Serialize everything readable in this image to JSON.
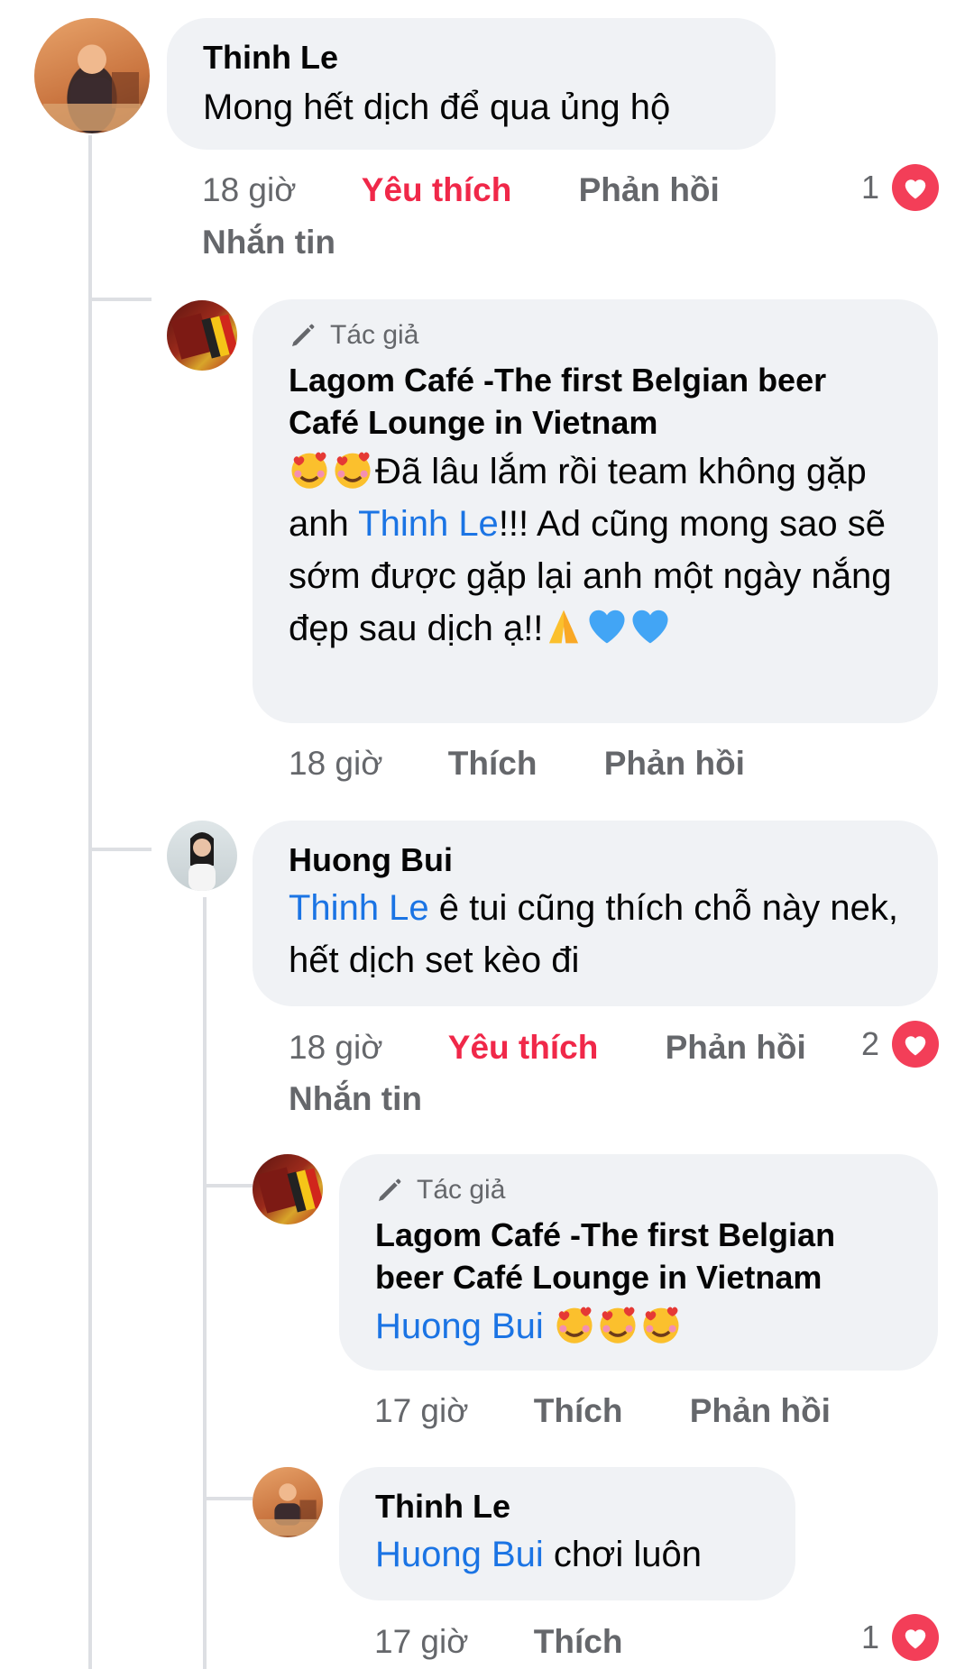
{
  "comments": [
    {
      "name": "Thinh Le",
      "text": "Mong hết dịch để qua ủng hộ",
      "time": "18 giờ",
      "like_label": "Yêu thích",
      "reply_label": "Phản hồi",
      "message_label": "Nhắn tin",
      "reaction_count": "1"
    },
    {
      "author_badge": "Tác giả",
      "name": "Lagom Café -The first Belgian beer Café Lounge in Vietnam",
      "name_line1": "Lagom Café -The first Belgian beer",
      "name_line2": "Café Lounge in Vietnam",
      "text_part1": "Đã lâu lắm rồi team không gặp anh",
      "mention": "Thinh Le",
      "text_part2": "!!! Ad cũng mong sao sẽ sớm được gặp lại anh một ngày nắng đẹp sau dịch ạ!!",
      "time": "18 giờ",
      "like_label": "Thích",
      "reply_label": "Phản hồi"
    },
    {
      "name": "Huong Bui",
      "mention": "Thinh Le",
      "text": " ê tui cũng thích chỗ này nek, hết dịch set kèo đi",
      "time": "18 giờ",
      "like_label": "Yêu thích",
      "reply_label": "Phản hồi",
      "message_label": "Nhắn tin",
      "reaction_count": "2"
    },
    {
      "author_badge": "Tác giả",
      "name_line1": "Lagom Café -The first Belgian",
      "name_line2": "beer Café Lounge in Vietnam",
      "mention": "Huong Bui",
      "time": "17 giờ",
      "like_label": "Thích",
      "reply_label": "Phản hồi"
    },
    {
      "name": "Thinh Le",
      "mention": "Huong Bui",
      "text": " chơi luôn",
      "time": "17 giờ",
      "like_label": "Thích",
      "reaction_count": "1"
    }
  ],
  "colors": {
    "bubble": "#f0f2f5",
    "mention": "#1b74e4",
    "liked": "#f02849",
    "heart": "#f33e58",
    "meta": "#65676b"
  }
}
